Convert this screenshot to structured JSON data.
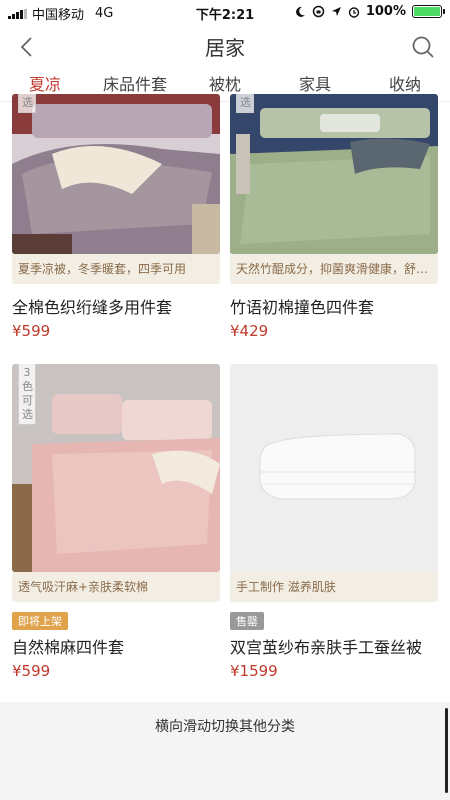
{
  "status": {
    "carrier": "中国移动",
    "network": "4G",
    "time": "下午2:21",
    "battery": "100%",
    "battery_level": 1.0
  },
  "nav": {
    "title": "居家"
  },
  "tabs": [
    {
      "label": "夏凉",
      "active": true
    },
    {
      "label": "床品件套"
    },
    {
      "label": "被枕"
    },
    {
      "label": "家具"
    },
    {
      "label": "收纳"
    }
  ],
  "products": [
    {
      "corner": "选",
      "tagline": "夏季凉被，冬季暖套，四季可用",
      "title": "全棉色织绗缝多用件套",
      "price": "¥599"
    },
    {
      "corner": "选",
      "tagline": "天然竹醌成分，抑菌爽滑健康，舒适享受",
      "title": "竹语初棉撞色四件套",
      "price": "¥429"
    },
    {
      "corner": "3色可选",
      "tagline": "透气吸汗麻+亲肤柔软棉",
      "badge": "即将上架",
      "title": "自然棉麻四件套",
      "price": "¥599"
    },
    {
      "tagline": "手工制作 滋养肌肤",
      "badge": "售罄",
      "title": "双宫茧纱布亲肤手工蚕丝被",
      "price": "¥1599"
    }
  ],
  "footer": {
    "hint": "横向滑动切换其他分类"
  },
  "colors": {
    "accent": "#c0392b",
    "tag_bg": "#f3eee4",
    "tag_text": "#8a6b4a"
  }
}
